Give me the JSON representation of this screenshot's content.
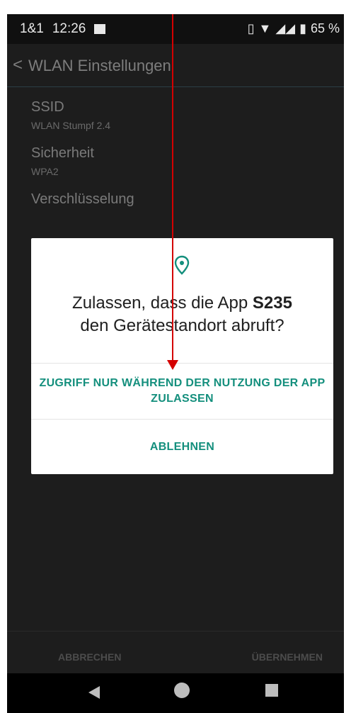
{
  "status_bar": {
    "carrier": "1&1",
    "time": "12:26",
    "battery": "65 %"
  },
  "app_bar": {
    "title": "WLAN Einstellungen"
  },
  "settings": [
    {
      "label": "SSID",
      "value": "WLAN Stumpf 2.4"
    },
    {
      "label": "Sicherheit",
      "value": "WPA2"
    },
    {
      "label": "Verschlüsselung",
      "value": ""
    }
  ],
  "dialog": {
    "question_prefix": "Zulassen, dass die App ",
    "app_name": "S235",
    "question_suffix": "den Gerätestandort abruft?",
    "allow_label": "ZUGRIFF NUR WÄHREND DER NUTZUNG DER APP ZULASSEN",
    "deny_label": "ABLEHNEN"
  },
  "bottom_bar": {
    "cancel_label": "ABBRECHEN",
    "apply_label": "ÜBERNEHMEN"
  },
  "accent_color": "#148f7d",
  "annotation_color": "#d40000"
}
